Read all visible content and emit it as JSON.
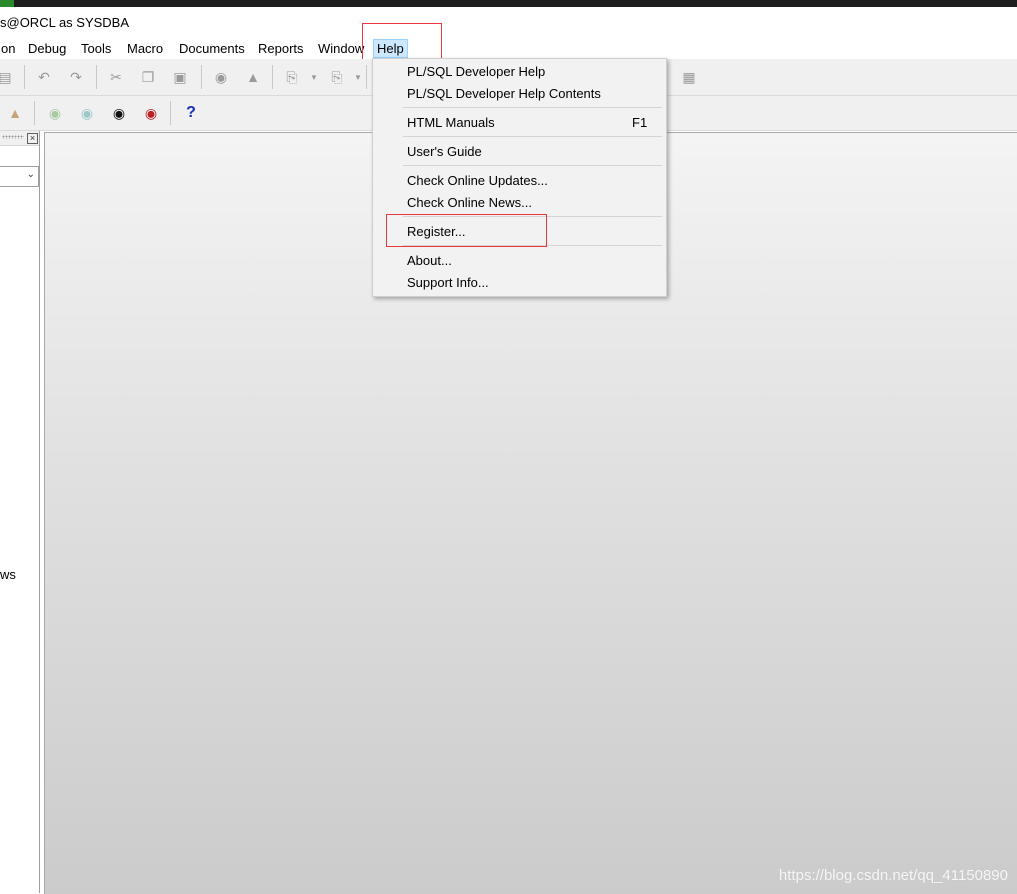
{
  "window": {
    "title": "s@ORCL as SYSDBA"
  },
  "menubar": {
    "items": [
      {
        "label": "on"
      },
      {
        "label": "Debug"
      },
      {
        "label": "Tools"
      },
      {
        "label": "Macro"
      },
      {
        "label": "Documents"
      },
      {
        "label": "Reports"
      },
      {
        "label": "Window"
      },
      {
        "label": "Help"
      }
    ]
  },
  "help_menu": {
    "items": [
      {
        "label": "PL/SQL Developer Help",
        "shortcut": ""
      },
      {
        "label": "PL/SQL Developer Help Contents",
        "shortcut": ""
      },
      {
        "label": "HTML Manuals",
        "shortcut": "F1"
      },
      {
        "label": "User's Guide",
        "shortcut": ""
      },
      {
        "label": "Check Online Updates...",
        "shortcut": ""
      },
      {
        "label": "Check Online News...",
        "shortcut": ""
      },
      {
        "label": "Register...",
        "shortcut": ""
      },
      {
        "label": "About...",
        "shortcut": ""
      },
      {
        "label": "Support Info...",
        "shortcut": ""
      }
    ]
  },
  "toolbar2": {
    "help_glyph": "?"
  },
  "left_panel": {
    "partial_text": "ws"
  },
  "watermark": "https://blog.csdn.net/qq_41150890",
  "colors": {
    "highlight_box": "#e8383d",
    "menu_active_bg": "#cce8ff",
    "help_icon": "#1a2fb5"
  },
  "icons": [
    "print-icon",
    "undo-icon",
    "redo-icon",
    "cut-icon",
    "copy-icon",
    "paste-icon",
    "find-icon",
    "replace-icon",
    "load-icon",
    "save-icon",
    "layout-icon",
    "session-icon",
    "db-icon",
    "sql-db-icon",
    "commit-icon",
    "rollback-icon",
    "help-icon"
  ]
}
